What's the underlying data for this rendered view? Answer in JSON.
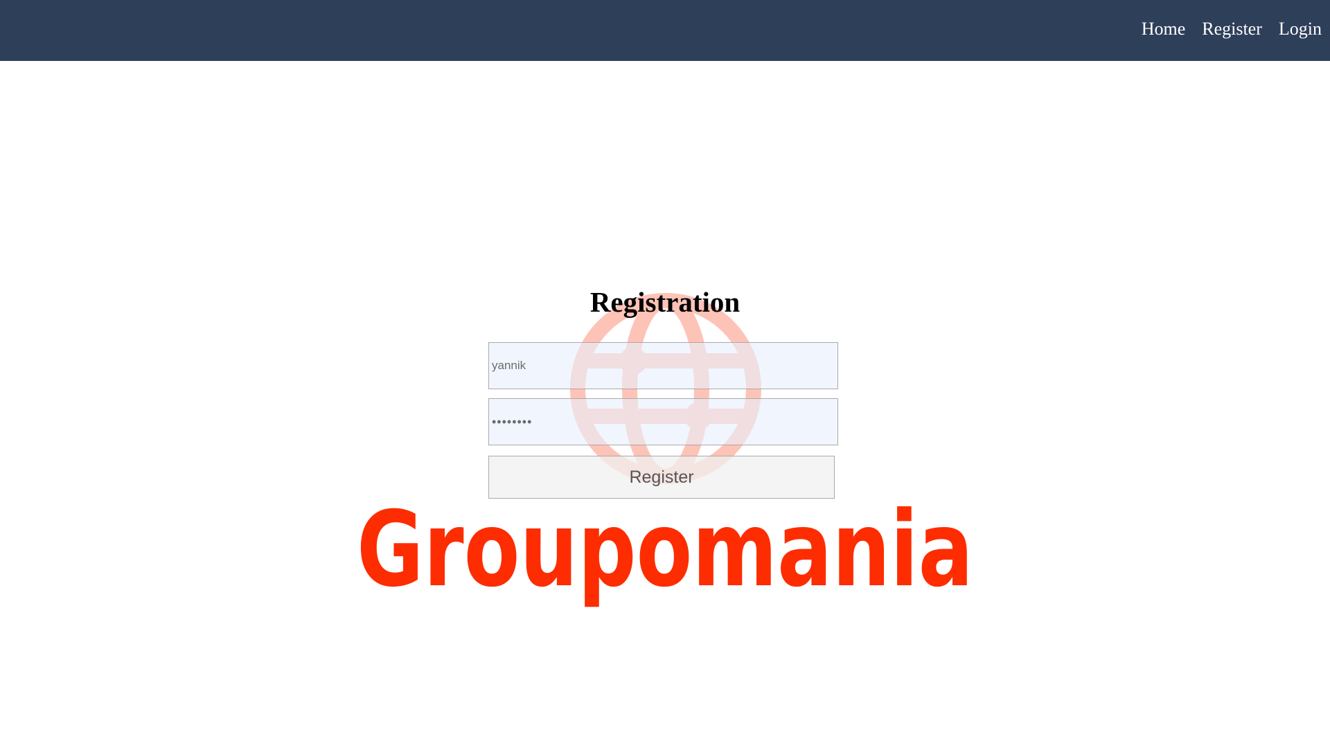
{
  "nav": {
    "items": [
      {
        "label": "Home"
      },
      {
        "label": "Register"
      },
      {
        "label": "Login"
      }
    ]
  },
  "form": {
    "title": "Registration",
    "username_value": "yannik",
    "password_value": "********",
    "submit_label": "Register"
  },
  "branding": {
    "logo_text": "Groupomania",
    "logo_icon": "globe-icon"
  },
  "colors": {
    "navbar": "#2e3f5a",
    "brand": "#fd2d01"
  }
}
